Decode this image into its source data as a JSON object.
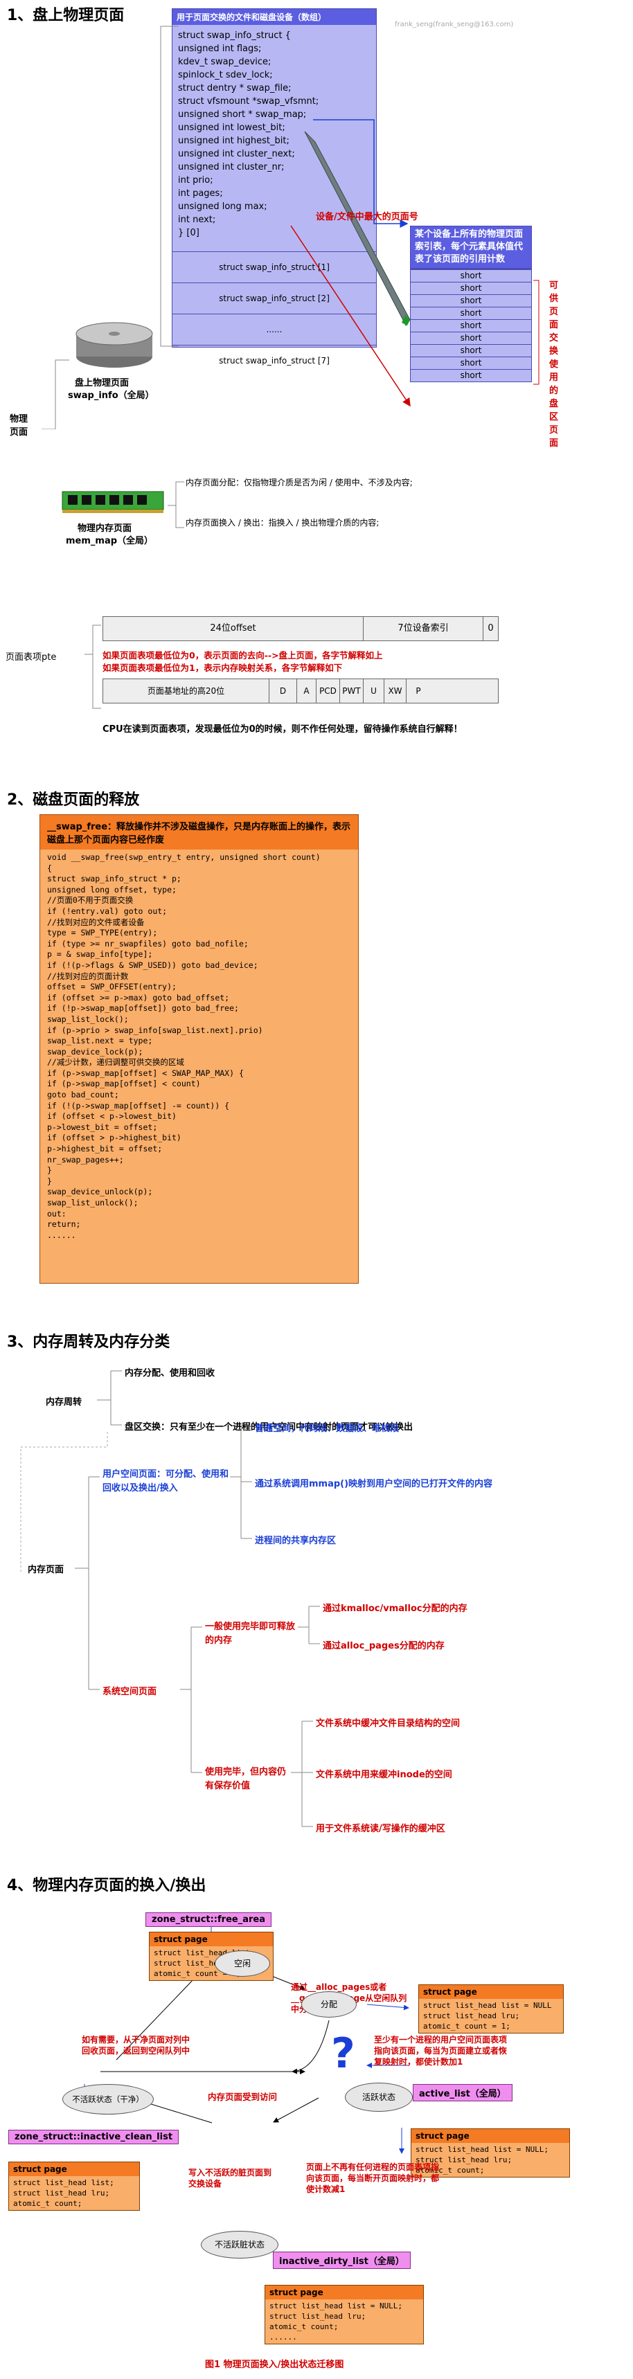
{
  "s1": {
    "title": "1、盘上物理页面",
    "watermark": "frank_seng(frank_seng@163.com)",
    "swap_header": "用于页面交换的文件和磁盘设备（数组）",
    "fields": [
      "struct swap_info_struct {",
      "unsigned int flags;",
      "kdev_t swap_device;",
      "spinlock_t sdev_lock;",
      "struct dentry * swap_file;",
      "struct vfsmount *swap_vfsmnt;",
      "unsigned short * swap_map;",
      "unsigned int lowest_bit;",
      "unsigned int highest_bit;",
      "unsigned int cluster_next;",
      "unsigned int cluster_nr;",
      "int prio;",
      "int pages;",
      "unsigned long max;",
      "int next;",
      "} [0]"
    ],
    "rows": [
      "struct swap_info_struct [1]",
      "struct swap_info_struct [2]",
      "......",
      "struct swap_info_struct [7]"
    ],
    "max_note": "设备/文件中最大的页面号",
    "map_header": "某个设备上所有的物理页面索引表，每个元素具体值代表了该页面的引用计数",
    "map_cells": [
      "short",
      "short",
      "short",
      "short",
      "short",
      "short",
      "short",
      "short",
      "short"
    ],
    "side_note": "可供页面交换使用的盘区页面",
    "disk_label1": "盘上物理页面",
    "disk_label2": "swap_info（全局）",
    "phys_label": "物理页面",
    "mem_label1": "物理内存页面",
    "mem_label2": "mem_map（全局）",
    "mem_note1": "内存页面分配：仅指物理介质是否为闲 / 使用中、不涉及内容;",
    "mem_note2": "内存页面换入 / 换出：指换入 / 换出物理介质的内容;",
    "pte_label": "页面表项pte",
    "pte_top": [
      "24位offset",
      "7位设备索引",
      "0"
    ],
    "pte_red1": "如果页面表项最低位为0，表示页面的去向-->盘上页面，各字节解释如上",
    "pte_red2": "如果页面表项最低位为1，表示内存映射关系，各字节解释如下",
    "pte_bottom": [
      "页面基地址的高20位",
      "D",
      "A",
      "PCD",
      "PWT",
      "U",
      "XW",
      "P"
    ],
    "cpu_note": "CPU在读到页面表项，发现最低位为0的时候，则不作任何处理，留待操作系统自行解释！"
  },
  "s2": {
    "title": "2、磁盘页面的释放",
    "header": "__swap_free：释放操作并不涉及磁盘操作，只是内存账面上的操作，表示磁盘上那个页面内容已经作废",
    "code": [
      "void __swap_free(swp_entry_t entry, unsigned short count)",
      "{",
      "struct swap_info_struct * p;",
      "unsigned long offset, type;",
      "//页面0不用于页面交换",
      "if (!entry.val) goto out;",
      "//找到对应的文件或者设备",
      "type = SWP_TYPE(entry);",
      "if (type >= nr_swapfiles) goto bad_nofile;",
      "p = & swap_info[type];",
      "if (!(p->flags & SWP_USED)) goto bad_device;",
      "//找到对应的页面计数",
      "offset = SWP_OFFSET(entry);",
      "if (offset >= p->max) goto bad_offset;",
      "if (!p->swap_map[offset]) goto bad_free;",
      "swap_list_lock();",
      "if (p->prio > swap_info[swap_list.next].prio)",
      "swap_list.next = type;",
      "swap_device_lock(p);",
      "//减少计数，递归调整可供交换的区域",
      "if (p->swap_map[offset] < SWAP_MAP_MAX) {",
      "if (p->swap_map[offset] < count)",
      "goto bad_count;",
      "if (!(p->swap_map[offset] -= count)) {",
      "if (offset < p->lowest_bit)",
      "p->lowest_bit = offset;",
      "if (offset > p->highest_bit)",
      "p->highest_bit = offset;",
      "nr_swap_pages++;",
      "}",
      "}",
      "swap_device_unlock(p);",
      "swap_list_unlock();",
      "out:",
      "return;",
      "......"
    ]
  },
  "s3": {
    "title": "3、内存周转及内存分类",
    "turn_label": "内存周转",
    "turn1": "内存分配、使用和回收",
    "turn2": "盘区交换：只有至少在一个进程的用户空间中有映射的页面才可以被换出",
    "mem_label": "内存页面",
    "user_space": "用户空间页面：可分配、使用和回收以及换出/换入",
    "user_items": [
      "普通空间，代码段、数据段、堆栈段",
      "通过系统调用mmap()映射到用户空间的已打开文件的内容",
      "进程间的共享内存区"
    ],
    "sys_space": "系统空间页面",
    "sys_a": "一般使用完毕即可释放的内存",
    "sys_a_items": [
      "通过kmalloc/vmalloc分配的内存",
      "通过alloc_pages分配的内存"
    ],
    "sys_b": "使用完毕，但内容仍有保存价值",
    "sys_b_items": [
      "文件系统中缓冲文件目录结构的空间",
      "文件系统中用来缓冲inode的空间",
      "用于文件系统读/写操作的缓冲区"
    ]
  },
  "s4": {
    "title": "4、物理内存页面的换入/换出",
    "free_area": "zone_struct::free_area",
    "sp_title": "struct page",
    "sp_code1": [
      "struct list_head list;",
      "struct list_head lru;",
      "atomic_t count = 0;"
    ],
    "alloc_note": "通过__alloc_pages或者__get_free_page从空闲队列中分配内存页面",
    "sp_code2": [
      "struct list_head list = NULL",
      "struct list_head lru;",
      "atomic_t count = 1;"
    ],
    "state_free": "空闲",
    "state_alloc": "分配",
    "reclaim_note": "如有需要，从干净页面对列中回收页面，返回到空闲队列中",
    "clean_state": "不活跃状态（干净）",
    "active_state": "活跃状态",
    "visit_note": "内存页面受到访问",
    "question": "?",
    "active_note": "至少有一个进程的用户空间页面表项指向该页面，每当为页面建立或者恢复映射时，都使计数加1",
    "inactive_clean": "zone_struct::inactive_clean_list",
    "active_list": "active_list（全局）",
    "sp_code3": [
      "struct list_head list;",
      "struct list_head lru;",
      "atomic_t count;"
    ],
    "sp_code4": [
      "struct list_head list = NULL;",
      "struct list_head lru;",
      "atomic_t count;"
    ],
    "write_note": "写入不活跃的脏页面到交换设备",
    "dirty_state": "不活跃脏状态",
    "dirty_note": "页面上不再有任何进程的页面表项指向该页面，每当断开页面映射时，都使计数减1",
    "inactive_dirty": "inactive_dirty_list（全局）",
    "sp_code5": [
      "struct list_head list = NULL;",
      "struct list_head lru;",
      "atomic_t count;",
      "......"
    ],
    "caption": "图1  物理页面换入/换出状态迁移图"
  }
}
